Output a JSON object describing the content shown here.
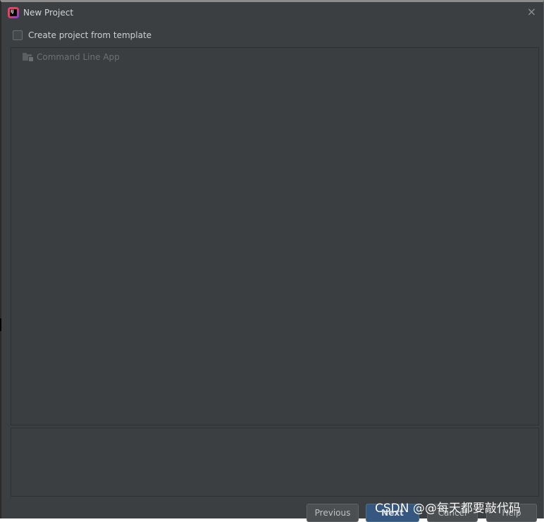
{
  "dialog": {
    "title": "New Project",
    "close_label": "×",
    "app_icon_text": "IJ"
  },
  "template_option": {
    "label": "Create project from template",
    "checked": false
  },
  "templates": [
    {
      "label": "Command Line App",
      "icon": "folder-icon"
    }
  ],
  "buttons": {
    "previous": "Previous",
    "next": "Next",
    "cancel": "Cancel",
    "help": "Help"
  },
  "watermark": "CSDN @@每天都要敲代码",
  "colors": {
    "background": "#3c3f41",
    "list_background": "#3b3e41",
    "primary_button": "#365880",
    "text": "#cdd0d2",
    "disabled_text": "#6d7174"
  }
}
